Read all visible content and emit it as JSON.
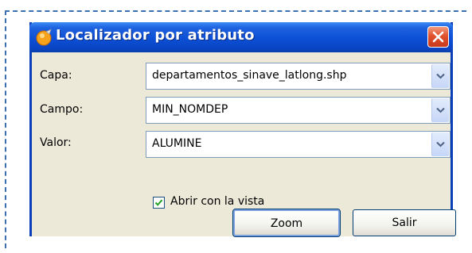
{
  "dialog": {
    "title": "Localizador por atributo",
    "icon": "gvsig-app-icon",
    "close_icon": "close-icon"
  },
  "fields": {
    "capa_label": "Capa:",
    "capa_value": "departamentos_sinave_latlong.shp",
    "campo_label": "Campo:",
    "campo_value": "MIN_NOMDEP",
    "valor_label": "Valor:",
    "valor_value": "ALUMINE"
  },
  "options": {
    "abrir_label": "Abrir con la vista",
    "abrir_checked": true
  },
  "buttons": {
    "zoom_label": "Zoom",
    "salir_label": "Salir"
  },
  "colors": {
    "titlebar": "#0a46c4",
    "frame_dashes": "#3a6fb0",
    "close_button": "#e0532d",
    "window_bg": "#ece9d8"
  }
}
